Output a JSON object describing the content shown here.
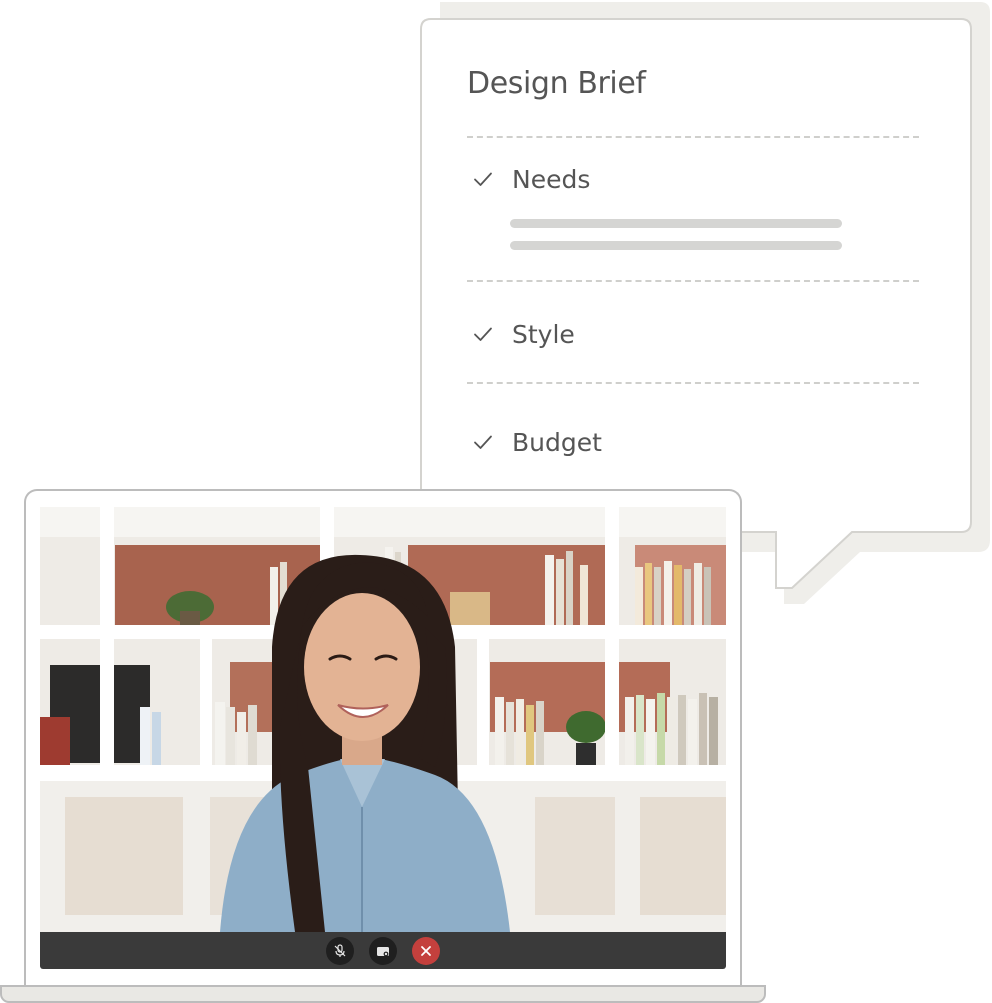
{
  "brief": {
    "title": "Design Brief",
    "items": [
      {
        "label": "Needs",
        "icon": "check-icon"
      },
      {
        "label": "Style",
        "icon": "check-icon"
      },
      {
        "label": "Budget",
        "icon": "check-icon"
      }
    ]
  },
  "video_call": {
    "controls": [
      {
        "icon": "mic-off-icon"
      },
      {
        "icon": "camera-icon"
      },
      {
        "icon": "end-call-icon"
      }
    ]
  },
  "colors": {
    "card_background": "#ffffff",
    "card_shadow": "#efeeea",
    "text": "#555555",
    "control_bar": "#3a3a3a",
    "end_call": "#c4403d"
  }
}
